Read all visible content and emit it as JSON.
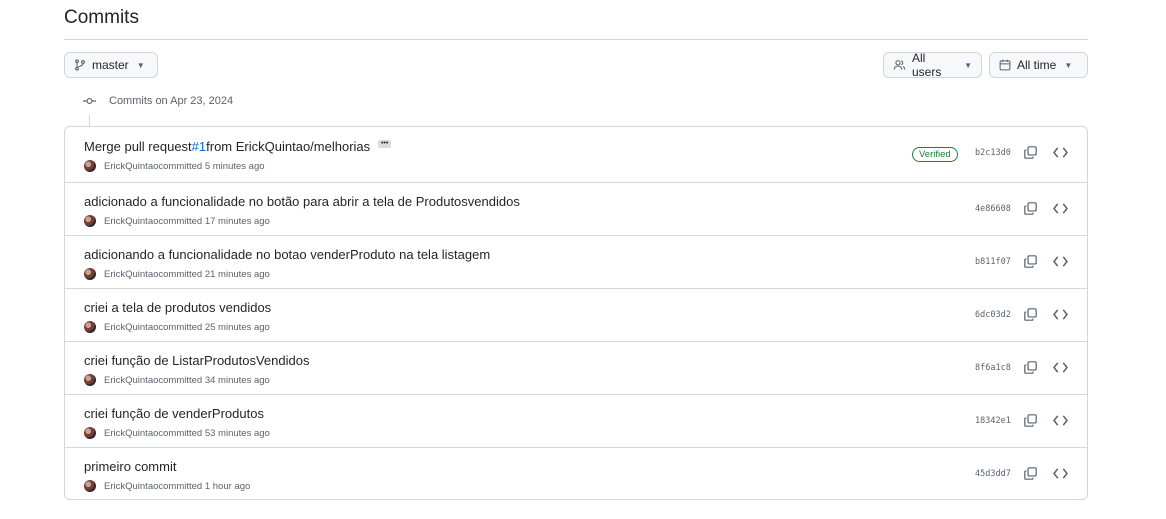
{
  "page": {
    "title": "Commits"
  },
  "filters": {
    "branch": {
      "label": "master",
      "icon": "git-branch-icon"
    },
    "users": {
      "label": "All users",
      "icon": "people-icon"
    },
    "time": {
      "label": "All time",
      "icon": "calendar-icon"
    }
  },
  "group": {
    "label": "Commits on Apr 23, 2024"
  },
  "commits": [
    {
      "message_prefix": "Merge pull request ",
      "pr_link": "#1",
      "message_suffix": " from ErickQuintao/melhorias",
      "author": "ErickQuintao",
      "time": " committed 5 minutes ago",
      "verified": "Verified",
      "sha": "b2c13d0"
    },
    {
      "message": "adicionado a funcionalidade no botão para abrir a tela de Produtosvendidos",
      "author": "ErickQuintao",
      "time": " committed 17 minutes ago",
      "sha": "4e86608"
    },
    {
      "message": "adicionando a funcionalidade no botao venderProduto na tela listagem",
      "author": "ErickQuintao",
      "time": " committed 21 minutes ago",
      "sha": "b811f07"
    },
    {
      "message": "criei a tela de produtos vendidos",
      "author": "ErickQuintao",
      "time": " committed 25 minutes ago",
      "sha": "6dc03d2"
    },
    {
      "message": "criei função de ListarProdutosVendidos",
      "author": "ErickQuintao",
      "time": " committed 34 minutes ago",
      "sha": "8f6a1c8"
    },
    {
      "message": "criei função de venderProdutos",
      "author": "ErickQuintao",
      "time": " committed 53 minutes ago",
      "sha": "18342e1"
    },
    {
      "message": "primeiro commit",
      "author": "ErickQuintao",
      "time": " committed 1 hour ago",
      "sha": "45d3dd7"
    }
  ],
  "colors": {
    "link": "#0969da",
    "verified": "#1a7f37",
    "border": "#d0d7de",
    "muted": "#59636e"
  }
}
